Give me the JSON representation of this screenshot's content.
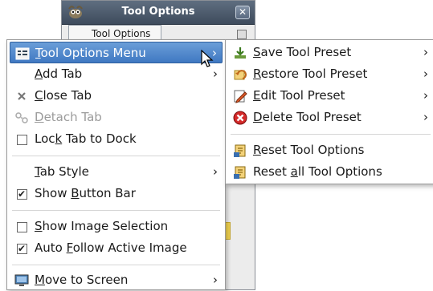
{
  "window": {
    "title": "Tool Options",
    "close_glyph": "✕",
    "tab_label": "Tool Options"
  },
  "main_menu": {
    "items": [
      {
        "label_pre": "",
        "label_u": "T",
        "label_post": "ool Options Menu",
        "icon": "tool-options-icon",
        "highlighted": true,
        "submenu": true
      },
      {
        "label_pre": "",
        "label_u": "A",
        "label_post": "dd Tab",
        "submenu": true
      },
      {
        "label_pre": "",
        "label_u": "C",
        "label_post": "lose Tab",
        "icon": "close-x-icon"
      },
      {
        "label_pre": "",
        "label_u": "D",
        "label_post": "etach Tab",
        "icon": "detach-icon",
        "disabled": true
      },
      {
        "label_pre": "Loc",
        "label_u": "k",
        "label_post": " Tab to Dock",
        "checkbox": true,
        "checked": false
      },
      {
        "label_pre": "",
        "label_u": "T",
        "label_post": "ab Style",
        "submenu": true
      },
      {
        "label_pre": "Show ",
        "label_u": "B",
        "label_post": "utton Bar",
        "checkbox": true,
        "checked": true
      },
      {
        "label_pre": "",
        "label_u": "S",
        "label_post": "how Image Selection",
        "checkbox": true,
        "checked": false
      },
      {
        "label_pre": "Auto ",
        "label_u": "F",
        "label_post": "ollow Active Image",
        "checkbox": true,
        "checked": true
      },
      {
        "label_pre": "",
        "label_u": "M",
        "label_post": "ove to Screen",
        "icon": "monitor-icon",
        "submenu": true
      }
    ],
    "arrow_glyph": "›",
    "check_glyph": "✔"
  },
  "sub_menu": {
    "items": [
      {
        "label_pre": "",
        "label_u": "S",
        "label_post": "ave Tool Preset",
        "icon": "save-preset-icon",
        "submenu": true
      },
      {
        "label_pre": "",
        "label_u": "R",
        "label_post": "estore Tool Preset",
        "icon": "restore-preset-icon",
        "submenu": true
      },
      {
        "label_pre": "",
        "label_u": "E",
        "label_post": "dit Tool Preset",
        "icon": "edit-preset-icon",
        "submenu": true
      },
      {
        "label_pre": "",
        "label_u": "D",
        "label_post": "elete Tool Preset",
        "icon": "delete-preset-icon",
        "submenu": true
      },
      {
        "label_pre": "",
        "label_u": "R",
        "label_post": "eset Tool Options",
        "icon": "reset-icon"
      },
      {
        "label_pre": "Reset ",
        "label_u": "a",
        "label_post": "ll Tool Options",
        "icon": "reset-all-icon"
      }
    ]
  },
  "colors": {
    "highlight": "#4a86cf",
    "titlebar": "#4b596b"
  }
}
